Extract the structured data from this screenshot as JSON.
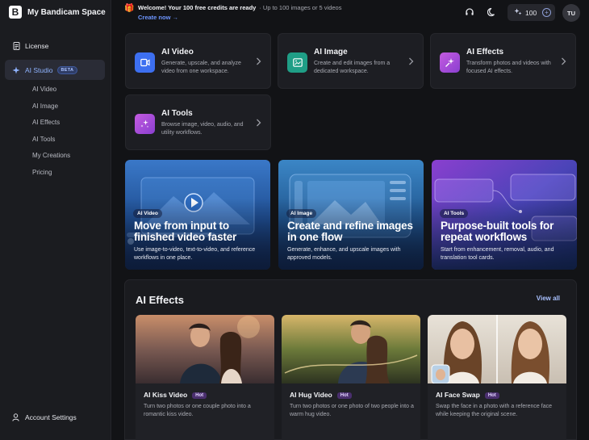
{
  "app": {
    "brand_letter": "B",
    "name": "My Bandicam Space"
  },
  "sidebar": {
    "license": "License",
    "ai_studio": "AI Studio",
    "beta": "BETA",
    "sub_items": [
      "AI Video",
      "AI Image",
      "AI Effects",
      "AI Tools",
      "My Creations",
      "Pricing"
    ],
    "account": "Account Settings"
  },
  "header": {
    "welcome": "Welcome! Your 100 free credits are ready",
    "welcome_detail": "· Up to 100 images or 5 videos",
    "create_now": "Create now →",
    "credits": "100",
    "avatar": "TU"
  },
  "features": [
    {
      "title": "AI Video",
      "desc": "Generate, upscale, and analyze video from one workspace.",
      "color": "#3d6ff0"
    },
    {
      "title": "AI Image",
      "desc": "Create and edit images from a dedicated workspace.",
      "color": "#1f9e86"
    },
    {
      "title": "AI Effects",
      "desc": "Transform photos and videos with focused AI effects.",
      "color": "#b24ad6"
    },
    {
      "title": "AI Tools",
      "desc": "Browse image, video, audio, and utility workflows.",
      "color": "#b04ad0"
    }
  ],
  "promos": [
    {
      "tag": "AI Video",
      "title": "Move from input to finished video faster",
      "desc": "Use image-to-video, text-to-video, and reference workflows in one place."
    },
    {
      "tag": "AI Image",
      "title": "Create and refine images in one flow",
      "desc": "Generate, enhance, and upscale images with approved models."
    },
    {
      "tag": "AI Tools",
      "title": "Purpose-built tools for repeat workflows",
      "desc": "Start from enhancement, removal, audio, and translation tool cards."
    }
  ],
  "effects": {
    "title": "AI Effects",
    "view_all": "View all",
    "cards": [
      {
        "title": "AI Kiss Video",
        "badge": "Hot",
        "desc": "Turn two photos or one couple photo into a romantic kiss video."
      },
      {
        "title": "AI Hug Video",
        "badge": "Hot",
        "desc": "Turn two photos or one photo of two people into a warm hug video."
      },
      {
        "title": "AI Face Swap",
        "badge": "Hot",
        "desc": "Swap the face in a photo with a reference face while keeping the original scene."
      }
    ]
  }
}
